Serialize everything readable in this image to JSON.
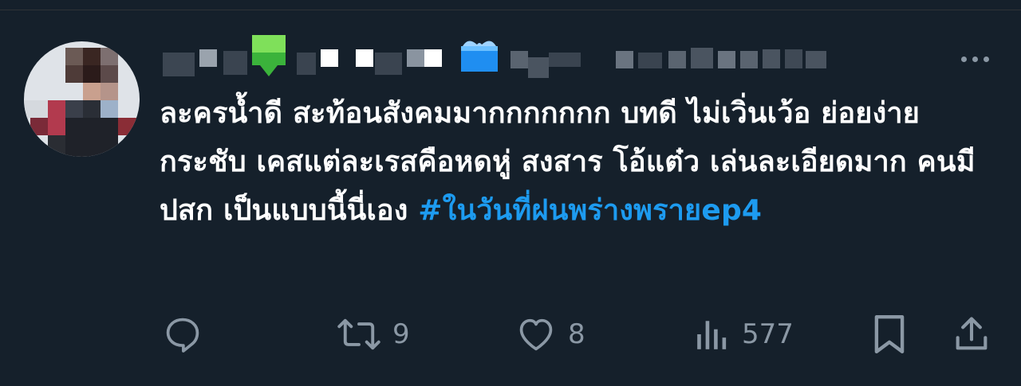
{
  "tweet": {
    "text": "ละครน้ำดี สะท้อนสังคมมากกกกกกก บทดี ไม่เวิ่นเว้อ ย่อยง่ายกระชับ เคสแต่ละเรสคือหดหู่ สงสาร โอ้แต๋ว เล่นละเอียดมาก คนมีปสก เป็นแบบนี้นี่เอง ",
    "hashtag": "#ในวันที่ฝนพร่างพรายep4"
  },
  "actions": {
    "reply": {
      "icon": "reply-icon",
      "count": ""
    },
    "retweet": {
      "icon": "retweet-icon",
      "count": "9"
    },
    "like": {
      "icon": "heart-icon",
      "count": "8"
    },
    "views": {
      "icon": "views-icon",
      "count": "577"
    },
    "bookmark": {
      "icon": "bookmark-icon"
    },
    "share": {
      "icon": "share-icon"
    }
  },
  "colors": {
    "background": "#15202b",
    "text": "#ffffff",
    "muted": "#8b98a5",
    "accent": "#1d9bf0"
  }
}
